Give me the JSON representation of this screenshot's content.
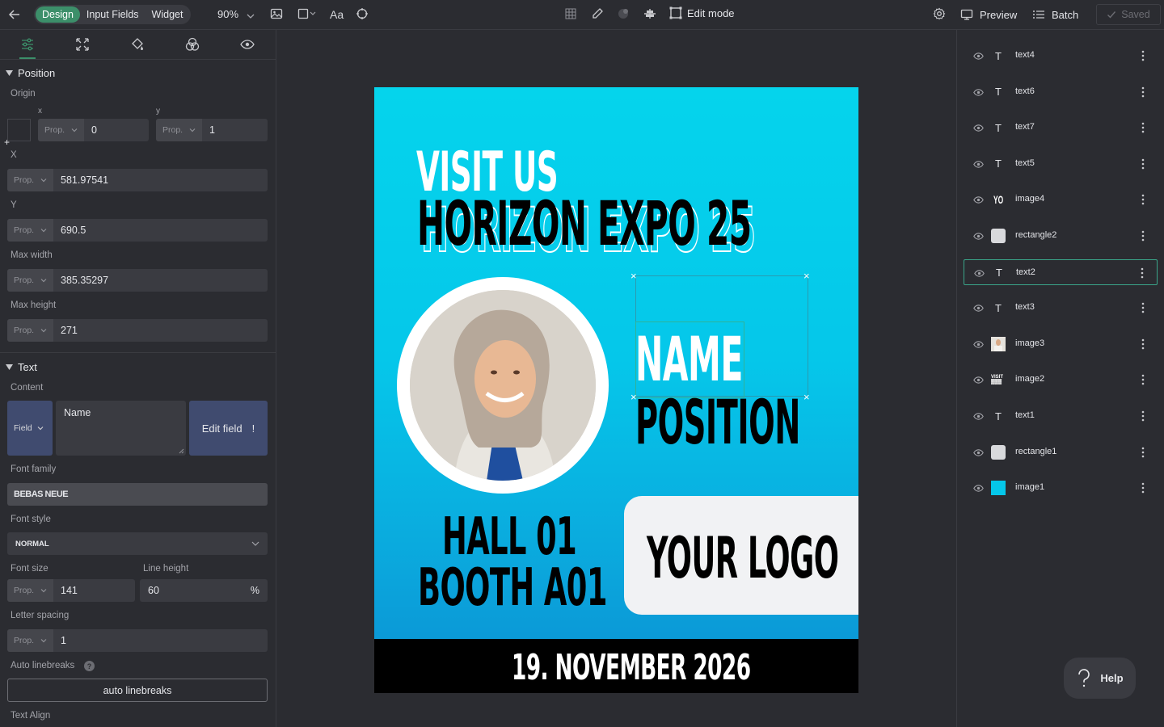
{
  "topbar": {
    "modes": [
      "Design",
      "Input Fields",
      "Widget"
    ],
    "active_mode": "Design",
    "zoom": "90%",
    "font_toggle": "Aa",
    "edit_mode_label": "Edit mode",
    "preview_label": "Preview",
    "batch_label": "Batch",
    "saved_label": "Saved"
  },
  "left_panel": {
    "position": {
      "section_title": "Position",
      "origin_label": "Origin",
      "origin_x_label": "x",
      "origin_y_label": "y",
      "prop_label": "Prop.",
      "origin_x_value": "0",
      "origin_y_value": "1",
      "x_label": "X",
      "x_value": "581.97541",
      "y_label": "Y",
      "y_value": "690.5",
      "max_width_label": "Max width",
      "max_width_value": "385.35297",
      "max_height_label": "Max height",
      "max_height_value": "271"
    },
    "text": {
      "section_title": "Text",
      "content_label": "Content",
      "field_type": "Field",
      "content_value": "Name",
      "edit_field_label": "Edit field",
      "edit_field_warning": "!",
      "font_family_label": "Font family",
      "font_family_value": "BEBAS NEUE",
      "font_style_label": "Font style",
      "font_style_value": "NORMAL",
      "font_size_label": "Font size",
      "font_size_value": "141",
      "line_height_label": "Line height",
      "line_height_value": "60",
      "line_height_unit": "%",
      "letter_spacing_label": "Letter spacing",
      "letter_spacing_value": "1",
      "auto_linebreaks_label": "Auto linebreaks",
      "auto_linebreaks_button": "auto linebreaks",
      "text_align_label": "Text Align"
    }
  },
  "poster": {
    "visit": "VISIT US",
    "event": "HORIZON EXPO 25",
    "name": "NAME",
    "position": "POSITION",
    "hall": "HALL 01",
    "booth": "BOOTH A01",
    "logo": "YOUR LOGO",
    "date": "19. NOVEMBER 2026"
  },
  "layers": [
    {
      "name": "text4",
      "kind": "T"
    },
    {
      "name": "text6",
      "kind": "T"
    },
    {
      "name": "text7",
      "kind": "T"
    },
    {
      "name": "text5",
      "kind": "T"
    },
    {
      "name": "image4",
      "kind": "YO"
    },
    {
      "name": "rectangle2",
      "kind": "rect-gray"
    },
    {
      "name": "text2",
      "kind": "T",
      "selected": true
    },
    {
      "name": "text3",
      "kind": "T"
    },
    {
      "name": "image3",
      "kind": "photo"
    },
    {
      "name": "image2",
      "kind": "visit"
    },
    {
      "name": "text1",
      "kind": "T"
    },
    {
      "name": "rectangle1",
      "kind": "rect-gray"
    },
    {
      "name": "image1",
      "kind": "rect-cyan"
    }
  ],
  "help_label": "Help",
  "colors": {
    "accent": "#3c8f6a",
    "panel_bg": "#2b2c31",
    "field_bg": "#3a3b41",
    "poster_cyan": "#05d4ec",
    "poster_blue": "#0b8fd3",
    "selection": "#3aa489"
  }
}
